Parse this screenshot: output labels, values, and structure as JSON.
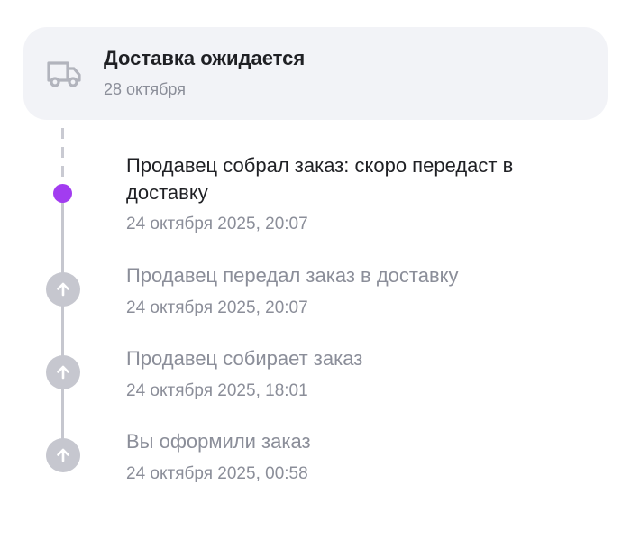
{
  "delivery": {
    "title": "Доставка ожидается",
    "date": "28 октября",
    "icon": "truck-icon"
  },
  "timeline": {
    "current": {
      "title_line1": "Продавец собрал заказ: скоро передаст в",
      "title_line2": "доставку",
      "time": "24 октября 2025, 20:07"
    },
    "past": [
      {
        "title": "Продавец передал заказ в доставку",
        "time": "24 октября 2025, 20:07"
      },
      {
        "title": "Продавец собирает заказ",
        "time": "24 октября 2025, 18:01"
      },
      {
        "title": "Вы оформили заказ",
        "time": "24 октября 2025, 00:58"
      }
    ]
  },
  "colors": {
    "accent": "#a23cf0",
    "inactive": "#c6c7cf",
    "muted_text": "#8b8e99",
    "primary_text": "#1f2024",
    "card_background": "#f2f3f7"
  }
}
